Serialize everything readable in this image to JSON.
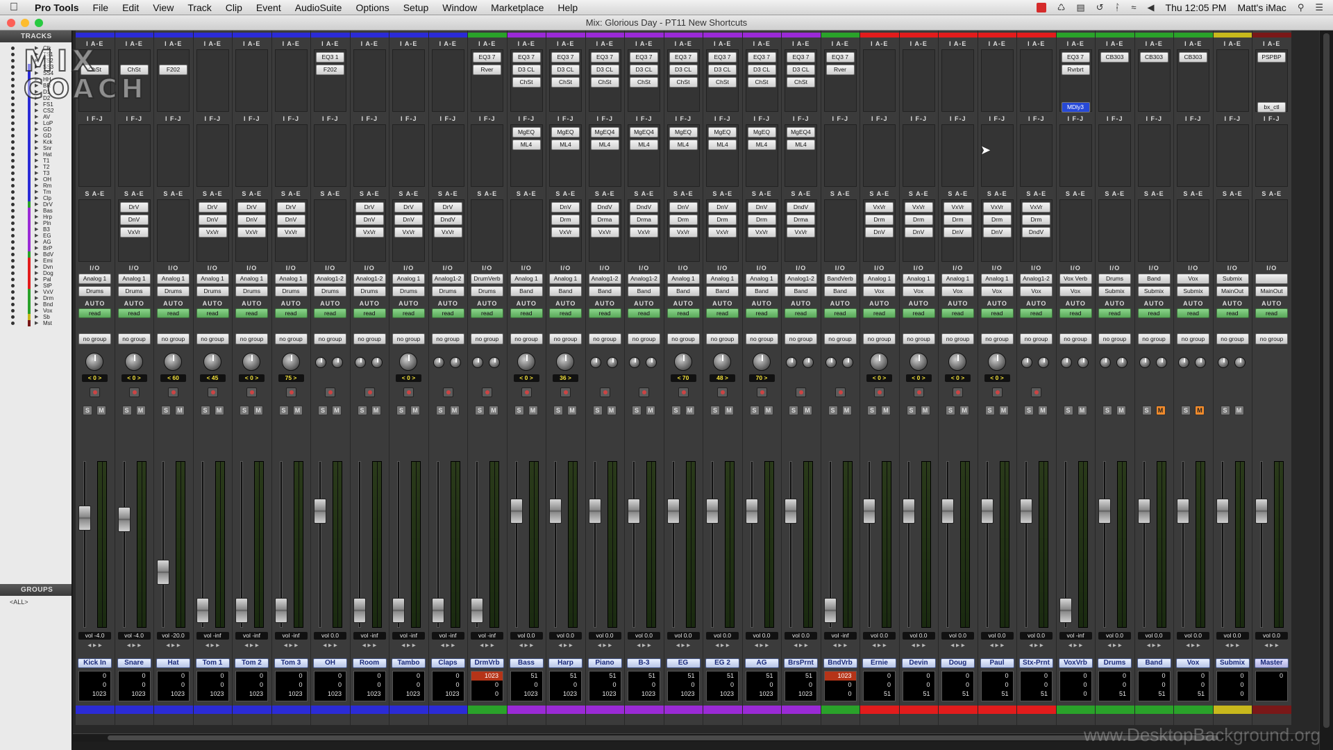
{
  "menubar": {
    "app": "Pro Tools",
    "items": [
      "File",
      "Edit",
      "View",
      "Track",
      "Clip",
      "Event",
      "AudioSuite",
      "Options",
      "Setup",
      "Window",
      "Marketplace",
      "Help"
    ],
    "clock": "Thu 12:05 PM",
    "user": "Matt's iMac"
  },
  "window": {
    "title": "Mix: Glorious Day - PT11 New Shortcuts"
  },
  "left": {
    "tracks_header": "TRACKS",
    "groups_header": "GROUPS",
    "groups_item": "<ALL>",
    "logo_line1": "MIX",
    "logo_line2": "COACH"
  },
  "sections": {
    "inserts_ae": "I A-E",
    "inserts_fj": "I F-J",
    "sends_ae": "S A-E",
    "io": "I/O",
    "auto": "AUTO"
  },
  "colors": {
    "blue": "#2b2bd6",
    "green": "#2aa22a",
    "purple": "#9a2ad6",
    "red": "#e21c1c",
    "olive": "#c8b81c",
    "maroon": "#7a1818"
  },
  "track_list": [
    {
      "n": "Clk",
      "c": ""
    },
    {
      "n": "TS1",
      "c": ""
    },
    {
      "n": "TS2",
      "c": ""
    },
    {
      "n": "SS3",
      "c": "#2b2bd6"
    },
    {
      "n": "SS4",
      "c": "#2b2bd6"
    },
    {
      "n": "HH",
      "c": "#2b2bd6"
    },
    {
      "n": "BR",
      "c": "#2b2bd6"
    },
    {
      "n": "D1",
      "c": "#2b2bd6"
    },
    {
      "n": "D2",
      "c": "#2b2bd6"
    },
    {
      "n": "FS1",
      "c": "#2b2bd6"
    },
    {
      "n": "CS2",
      "c": "#2b2bd6"
    },
    {
      "n": "AV",
      "c": "#2b2bd6"
    },
    {
      "n": "LoP",
      "c": "#2b2bd6"
    },
    {
      "n": "GD",
      "c": "#2b2bd6"
    },
    {
      "n": "GD",
      "c": "#2b2bd6"
    },
    {
      "n": "Kck",
      "c": "#2b2bd6"
    },
    {
      "n": "Snr",
      "c": "#2b2bd6"
    },
    {
      "n": "Hat",
      "c": "#2b2bd6"
    },
    {
      "n": "T1",
      "c": "#2b2bd6"
    },
    {
      "n": "T2",
      "c": "#2b2bd6"
    },
    {
      "n": "T3",
      "c": "#2b2bd6"
    },
    {
      "n": "OH",
      "c": "#2b2bd6"
    },
    {
      "n": "Rm",
      "c": "#2b2bd6"
    },
    {
      "n": "Tm",
      "c": "#2b2bd6"
    },
    {
      "n": "Clp",
      "c": "#2b2bd6"
    },
    {
      "n": "DrV",
      "c": "#2aa22a"
    },
    {
      "n": "Bas",
      "c": "#9a2ad6"
    },
    {
      "n": "Hrp",
      "c": "#9a2ad6"
    },
    {
      "n": "Pln",
      "c": "#9a2ad6"
    },
    {
      "n": "B3",
      "c": "#9a2ad6"
    },
    {
      "n": "EG",
      "c": "#9a2ad6"
    },
    {
      "n": "AG",
      "c": "#9a2ad6"
    },
    {
      "n": "BrP",
      "c": "#9a2ad6"
    },
    {
      "n": "BdV",
      "c": "#2aa22a"
    },
    {
      "n": "Emi",
      "c": "#e21c1c"
    },
    {
      "n": "Dvn",
      "c": "#e21c1c"
    },
    {
      "n": "Dog",
      "c": "#e21c1c"
    },
    {
      "n": "Pal",
      "c": "#e21c1c"
    },
    {
      "n": "StP",
      "c": "#e21c1c"
    },
    {
      "n": "VxV",
      "c": "#2aa22a"
    },
    {
      "n": "Drm",
      "c": "#2aa22a"
    },
    {
      "n": "Bnd",
      "c": "#2aa22a"
    },
    {
      "n": "Vox",
      "c": "#2aa22a"
    },
    {
      "n": "Sb",
      "c": "#c8b81c"
    },
    {
      "n": "Mst",
      "c": "#7a1818"
    }
  ],
  "strips": [
    {
      "name": "Kick In",
      "color": "blue",
      "ins1": [
        "",
        "ChSt"
      ],
      "ins2": [],
      "sends": [],
      "in": "Analog 1",
      "out": "Drums",
      "auto": "read",
      "group": "no group",
      "pan": "< 0 >",
      "knobs": 1,
      "fader": 0.68,
      "vol": "vol -4.0",
      "d1": "0",
      "d2": "0",
      "d3": "1023"
    },
    {
      "name": "Snare",
      "color": "blue",
      "ins1": [
        "",
        "ChSt"
      ],
      "ins2": [],
      "sends": [
        "DrV",
        "DnV",
        "VxVr"
      ],
      "in": "Analog 1",
      "out": "Drums",
      "auto": "read",
      "group": "no group",
      "pan": "< 0 >",
      "knobs": 1,
      "fader": 0.67,
      "vol": "vol -4.0",
      "d1": "0",
      "d2": "0",
      "d3": "1023"
    },
    {
      "name": "Hat",
      "color": "blue",
      "ins1": [
        "",
        "F202"
      ],
      "ins2": [],
      "sends": [],
      "in": "Analog 1",
      "out": "Drums",
      "auto": "read",
      "group": "no group",
      "pan": "< 60",
      "knobs": 1,
      "fader": 0.34,
      "vol": "vol -20.0",
      "d1": "0",
      "d2": "0",
      "d3": "1023"
    },
    {
      "name": "Tom 1",
      "color": "blue",
      "ins1": [],
      "ins2": [],
      "sends": [
        "DrV",
        "DnV",
        "VxVr"
      ],
      "in": "Analog 1",
      "out": "Drums",
      "auto": "read",
      "group": "no group",
      "pan": "< 45",
      "knobs": 1,
      "fader": 0.1,
      "vol": "vol -inf",
      "d1": "0",
      "d2": "0",
      "d3": "1023"
    },
    {
      "name": "Tom 2",
      "color": "blue",
      "ins1": [],
      "ins2": [],
      "sends": [
        "DrV",
        "DnV",
        "VxVr"
      ],
      "in": "Analog 1",
      "out": "Drums",
      "auto": "read",
      "group": "no group",
      "pan": "< 0 >",
      "knobs": 1,
      "fader": 0.1,
      "vol": "vol -inf",
      "d1": "0",
      "d2": "0",
      "d3": "1023"
    },
    {
      "name": "Tom 3",
      "color": "blue",
      "ins1": [],
      "ins2": [],
      "sends": [
        "DrV",
        "DnV",
        "VxVr"
      ],
      "in": "Analog 1",
      "out": "Drums",
      "auto": "read",
      "group": "no group",
      "pan": "75 >",
      "knobs": 1,
      "fader": 0.1,
      "vol": "vol -inf",
      "d1": "0",
      "d2": "0",
      "d3": "1023"
    },
    {
      "name": "OH",
      "color": "blue",
      "ins1": [
        "EQ3 1",
        "F202"
      ],
      "ins2": [],
      "sends": [],
      "in": "Analog1-2",
      "out": "Drums",
      "auto": "read",
      "group": "no group",
      "pan": "",
      "knobs": 2,
      "fader": 0.72,
      "vol": "vol 0.0",
      "d1": "0",
      "d2": "0",
      "d3": "1023"
    },
    {
      "name": "Room",
      "color": "blue",
      "ins1": [],
      "ins2": [],
      "sends": [
        "DrV",
        "DnV",
        "VxVr"
      ],
      "in": "Analog1-2",
      "out": "Drums",
      "auto": "read",
      "group": "no group",
      "pan": "",
      "knobs": 2,
      "fader": 0.1,
      "vol": "vol -inf",
      "d1": "0",
      "d2": "0",
      "d3": "1023"
    },
    {
      "name": "Tambo",
      "color": "blue",
      "ins1": [],
      "ins2": [],
      "sends": [
        "DrV",
        "DnV",
        "VxVr"
      ],
      "in": "Analog 1",
      "out": "Drums",
      "auto": "read",
      "group": "no group",
      "pan": "< 0 >",
      "knobs": 1,
      "fader": 0.1,
      "vol": "vol -inf",
      "d1": "0",
      "d2": "0",
      "d3": "1023"
    },
    {
      "name": "Claps",
      "color": "blue",
      "ins1": [],
      "ins2": [],
      "sends": [
        "DrV",
        "DndV",
        "VxVr"
      ],
      "in": "Analog1-2",
      "out": "Drums",
      "auto": "read",
      "group": "no group",
      "pan": "",
      "knobs": 2,
      "fader": 0.1,
      "vol": "vol -inf",
      "d1": "0",
      "d2": "0",
      "d3": "1023"
    },
    {
      "name": "DrmVrb",
      "color": "green",
      "ins1": [
        "EQ3 7",
        "Rver"
      ],
      "ins2": [],
      "sends": [],
      "in": "DrumVerb",
      "out": "Drums",
      "auto": "read",
      "group": "no group",
      "pan": "",
      "knobs": 2,
      "fader": 0.1,
      "vol": "vol -inf",
      "d1": "1023",
      "d2": "0",
      "d3": "0",
      "hi": true
    },
    {
      "name": "Bass",
      "color": "purple",
      "ins1": [
        "EQ3 7",
        "D3 CL",
        "ChSt"
      ],
      "ins2": [
        "MgEQ",
        "ML4"
      ],
      "sends": [],
      "in": "Analog 1",
      "out": "Band",
      "auto": "read",
      "group": "no group",
      "pan": "< 0 >",
      "knobs": 1,
      "fader": 0.72,
      "vol": "vol 0.0",
      "d1": "51",
      "d2": "0",
      "d3": "1023"
    },
    {
      "name": "Harp",
      "color": "purple",
      "ins1": [
        "EQ3 7",
        "D3 CL",
        "ChSt"
      ],
      "ins2": [
        "MgEQ",
        "ML4"
      ],
      "sends": [
        "DnV",
        "Drm",
        "VxVr"
      ],
      "in": "Analog 1",
      "out": "Band",
      "auto": "read",
      "group": "no group",
      "pan": "36 >",
      "knobs": 1,
      "fader": 0.72,
      "vol": "vol 0.0",
      "d1": "51",
      "d2": "0",
      "d3": "1023"
    },
    {
      "name": "Piano",
      "color": "purple",
      "ins1": [
        "EQ3 7",
        "D3 CL",
        "ChSt"
      ],
      "ins2": [
        "MgEQ4",
        "ML4"
      ],
      "sends": [
        "DndV",
        "Drma",
        "VxVr"
      ],
      "in": "Analog1-2",
      "out": "Band",
      "auto": "read",
      "group": "no group",
      "pan": "",
      "knobs": 2,
      "fader": 0.72,
      "vol": "vol 0.0",
      "d1": "51",
      "d2": "0",
      "d3": "1023"
    },
    {
      "name": "B-3",
      "color": "purple",
      "ins1": [
        "EQ3 7",
        "D3 CL",
        "ChSt"
      ],
      "ins2": [
        "MgEQ4",
        "ML4"
      ],
      "sends": [
        "DndV",
        "Drma",
        "VxVr"
      ],
      "in": "Analog1-2",
      "out": "Band",
      "auto": "read",
      "group": "no group",
      "pan": "",
      "knobs": 2,
      "fader": 0.72,
      "vol": "vol 0.0",
      "d1": "51",
      "d2": "0",
      "d3": "1023"
    },
    {
      "name": "EG",
      "color": "purple",
      "ins1": [
        "EQ3 7",
        "D3 CL",
        "ChSt"
      ],
      "ins2": [
        "MgEQ",
        "ML4"
      ],
      "sends": [
        "DnV",
        "Drm",
        "VxVr"
      ],
      "in": "Analog 1",
      "out": "Band",
      "auto": "read",
      "group": "no group",
      "pan": "< 70",
      "knobs": 1,
      "fader": 0.72,
      "vol": "vol 0.0",
      "d1": "51",
      "d2": "0",
      "d3": "1023"
    },
    {
      "name": "EG 2",
      "color": "purple",
      "ins1": [
        "EQ3 7",
        "D3 CL",
        "ChSt"
      ],
      "ins2": [
        "MgEQ",
        "ML4"
      ],
      "sends": [
        "DnV",
        "Drm",
        "VxVr"
      ],
      "in": "Analog 1",
      "out": "Band",
      "auto": "read",
      "group": "no group",
      "pan": "48 >",
      "knobs": 1,
      "fader": 0.72,
      "vol": "vol 0.0",
      "d1": "51",
      "d2": "0",
      "d3": "1023"
    },
    {
      "name": "AG",
      "color": "purple",
      "ins1": [
        "EQ3 7",
        "D3 CL",
        "ChSt"
      ],
      "ins2": [
        "MgEQ",
        "ML4"
      ],
      "sends": [
        "DnV",
        "Drm",
        "VxVr"
      ],
      "in": "Analog 1",
      "out": "Band",
      "auto": "read",
      "group": "no group",
      "pan": "70 >",
      "knobs": 1,
      "fader": 0.72,
      "vol": "vol 0.0",
      "d1": "51",
      "d2": "0",
      "d3": "1023"
    },
    {
      "name": "BrsPrnt",
      "color": "purple",
      "ins1": [
        "EQ3 7",
        "D3 CL",
        "ChSt"
      ],
      "ins2": [
        "MgEQ4",
        "ML4"
      ],
      "sends": [
        "DndV",
        "Drma",
        "VxVr"
      ],
      "in": "Analog1-2",
      "out": "Band",
      "auto": "read",
      "group": "no group",
      "pan": "",
      "knobs": 2,
      "fader": 0.72,
      "vol": "vol 0.0",
      "d1": "51",
      "d2": "0",
      "d3": "1023"
    },
    {
      "name": "BndVrb",
      "color": "green",
      "ins1": [
        "EQ3 7",
        "Rver"
      ],
      "ins2": [],
      "sends": [],
      "in": "BandVerb",
      "out": "Band",
      "auto": "read",
      "group": "no group",
      "pan": "",
      "knobs": 2,
      "fader": 0.1,
      "vol": "vol -inf",
      "d1": "1023",
      "d2": "0",
      "d3": "0",
      "hi": true
    },
    {
      "name": "Ernie",
      "color": "red",
      "ins1": [],
      "ins2": [],
      "sends": [
        "VxVr",
        "Drm",
        "DnV"
      ],
      "in": "Analog 1",
      "out": "Vox",
      "auto": "read",
      "group": "no group",
      "pan": "< 0 >",
      "knobs": 1,
      "fader": 0.72,
      "vol": "vol 0.0",
      "d1": "0",
      "d2": "0",
      "d3": "51"
    },
    {
      "name": "Devin",
      "color": "red",
      "ins1": [],
      "ins2": [],
      "sends": [
        "VxVr",
        "Drm",
        "DnV"
      ],
      "in": "Analog 1",
      "out": "Vox",
      "auto": "read",
      "group": "no group",
      "pan": "< 0 >",
      "knobs": 1,
      "fader": 0.72,
      "vol": "vol 0.0",
      "d1": "0",
      "d2": "0",
      "d3": "51"
    },
    {
      "name": "Doug",
      "color": "red",
      "ins1": [],
      "ins2": [],
      "sends": [
        "VxVr",
        "Drm",
        "DnV"
      ],
      "in": "Analog 1",
      "out": "Vox",
      "auto": "read",
      "group": "no group",
      "pan": "< 0 >",
      "knobs": 1,
      "fader": 0.72,
      "vol": "vol 0.0",
      "d1": "0",
      "d2": "0",
      "d3": "51"
    },
    {
      "name": "Paul",
      "color": "red",
      "ins1": [],
      "ins2": [],
      "sends": [
        "VxVr",
        "Drm",
        "DnV"
      ],
      "in": "Analog 1",
      "out": "Vox",
      "auto": "read",
      "group": "no group",
      "pan": "< 0 >",
      "knobs": 1,
      "fader": 0.72,
      "vol": "vol 0.0",
      "d1": "0",
      "d2": "0",
      "d3": "51"
    },
    {
      "name": "Stx-Prnt",
      "color": "red",
      "ins1": [],
      "ins2": [],
      "sends": [
        "VxVr",
        "Drm",
        "DndV"
      ],
      "in": "Analog1-2",
      "out": "Vox",
      "auto": "read",
      "group": "no group",
      "pan": "",
      "knobs": 2,
      "fader": 0.72,
      "vol": "vol 0.0",
      "d1": "0",
      "d2": "0",
      "d3": "51"
    },
    {
      "name": "VoxVrb",
      "color": "green",
      "ins1": [
        "EQ3 7",
        "Rvrbrt",
        "",
        "",
        "MDly3"
      ],
      "ins2": [],
      "sends": [],
      "in": "Vox Verb",
      "out": "Vox",
      "auto": "read",
      "group": "no group",
      "pan": "",
      "knobs": 2,
      "fader": 0.1,
      "vol": "vol -inf",
      "d1": "0",
      "d2": "0",
      "d3": "0"
    },
    {
      "name": "Drums",
      "color": "green",
      "ins1": [
        "CB303"
      ],
      "ins2": [],
      "sends": [],
      "in": "Drums",
      "out": "Submix",
      "auto": "read",
      "group": "no group",
      "pan": "",
      "knobs": 2,
      "fader": 0.72,
      "vol": "vol 0.0",
      "d1": "0",
      "d2": "0",
      "d3": "51"
    },
    {
      "name": "Band",
      "color": "green",
      "ins1": [
        "CB303"
      ],
      "ins2": [],
      "sends": [],
      "in": "Band",
      "out": "Submix",
      "auto": "read",
      "group": "no group",
      "pan": "",
      "knobs": 2,
      "fader": 0.72,
      "vol": "vol 0.0",
      "d1": "0",
      "d2": "0",
      "d3": "51",
      "orange": true
    },
    {
      "name": "Vox",
      "color": "green",
      "ins1": [
        "CB303"
      ],
      "ins2": [],
      "sends": [],
      "in": "Vox",
      "out": "Submix",
      "auto": "read",
      "group": "no group",
      "pan": "",
      "knobs": 2,
      "fader": 0.72,
      "vol": "vol 0.0",
      "d1": "0",
      "d2": "0",
      "d3": "51",
      "orange": true
    },
    {
      "name": "Submix",
      "color": "olive",
      "ins1": [],
      "ins2": [],
      "sends": [],
      "in": "Submix",
      "out": "MainOut",
      "auto": "read",
      "group": "no group",
      "pan": "",
      "knobs": 2,
      "fader": 0.72,
      "vol": "vol 0.0",
      "d1": "0",
      "d2": "0",
      "d3": "0"
    },
    {
      "name": "Master",
      "color": "maroon",
      "ins1": [
        "PSPBP",
        "",
        "",
        "",
        "bx_ctl"
      ],
      "ins2": [],
      "sends": [],
      "in": "",
      "out": "MainOut",
      "auto": "read",
      "group": "no group",
      "pan": "",
      "knobs": 0,
      "fader": 0.72,
      "vol": "vol 0.0",
      "d1": "0",
      "d2": "",
      "d3": "",
      "master": true
    }
  ],
  "watermark": "www.DesktopBackground.org"
}
